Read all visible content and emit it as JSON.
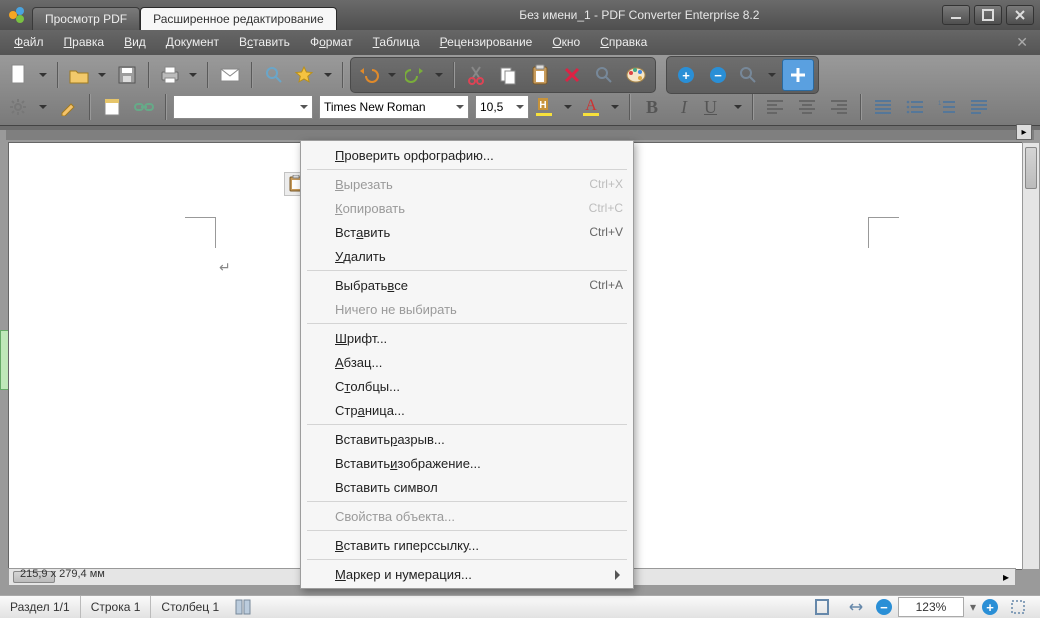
{
  "titlebar": {
    "tab_inactive": "Просмотр PDF",
    "tab_active": "Расширенное редактирование",
    "title": "Без имени_1 - PDF Converter Enterprise 8.2"
  },
  "menu": {
    "items": [
      "Файл",
      "Правка",
      "Вид",
      "Документ",
      "Вставить",
      "Формат",
      "Таблица",
      "Рецензирование",
      "Окно",
      "Справка"
    ]
  },
  "toolbar2": {
    "font": "Times New Roman",
    "size": "10,5"
  },
  "context_menu": {
    "items": [
      {
        "label": "Проверить орфографию...",
        "enabled": true,
        "u": 0
      },
      {
        "sep": true
      },
      {
        "label": "Вырезать",
        "enabled": false,
        "shortcut": "Ctrl+X",
        "u": 0
      },
      {
        "label": "Копировать",
        "enabled": false,
        "shortcut": "Ctrl+C",
        "u": 0
      },
      {
        "label": "Вставить",
        "enabled": true,
        "shortcut": "Ctrl+V",
        "u": 3
      },
      {
        "label": "Удалить",
        "enabled": true,
        "u": 0
      },
      {
        "sep": true
      },
      {
        "label": "Выбрать все",
        "enabled": true,
        "shortcut": "Ctrl+A",
        "u": 8
      },
      {
        "label": "Ничего не выбирать",
        "enabled": false
      },
      {
        "sep": true
      },
      {
        "label": "Шрифт...",
        "enabled": true,
        "u": 0
      },
      {
        "label": "Абзац...",
        "enabled": true,
        "u": 0
      },
      {
        "label": "Столбцы...",
        "enabled": true,
        "u": 1
      },
      {
        "label": "Страница...",
        "enabled": true,
        "u": 3
      },
      {
        "sep": true
      },
      {
        "label": "Вставить разрыв...",
        "enabled": true,
        "u": 9
      },
      {
        "label": "Вставить изображение...",
        "enabled": true,
        "u": 9
      },
      {
        "label": "Вставить символ",
        "enabled": true
      },
      {
        "sep": true
      },
      {
        "label": "Свойства объекта...",
        "enabled": false
      },
      {
        "sep": true
      },
      {
        "label": "Вставить гиперссылку...",
        "enabled": true,
        "u": 0
      },
      {
        "sep": true
      },
      {
        "label": "Маркер и нумерация...",
        "enabled": true,
        "u": 0,
        "arrow": true
      }
    ]
  },
  "status": {
    "dims": "215,9 x 279,4 мм",
    "section": "Раздел 1/1",
    "row": "Строка 1",
    "col": "Столбец 1",
    "zoom": "123%"
  }
}
